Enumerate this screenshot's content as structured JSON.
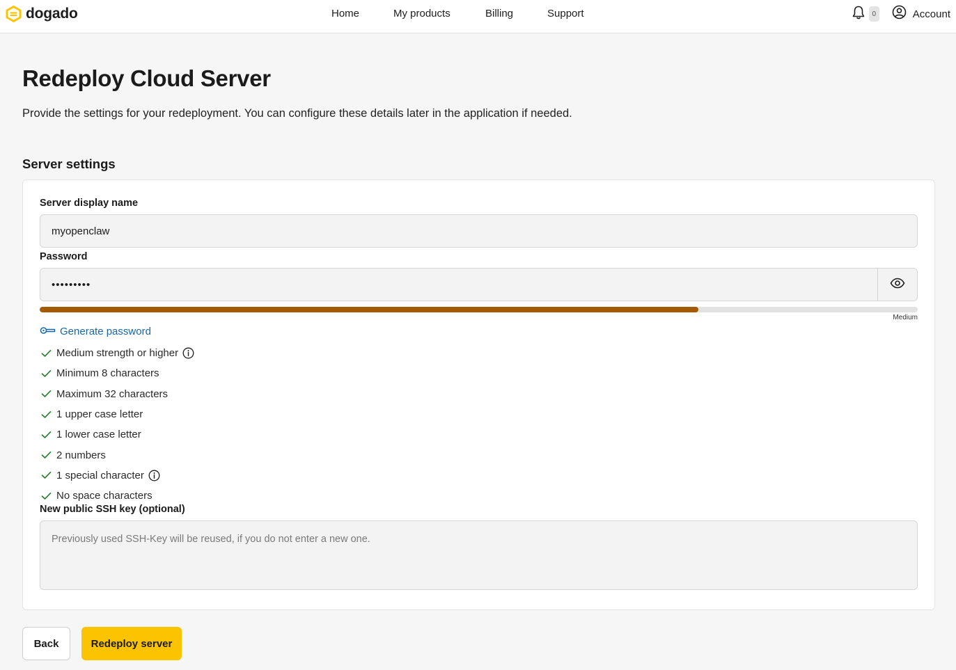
{
  "header": {
    "brand": "dogado",
    "brand_color": "#fcc400",
    "nav": [
      {
        "label": "Home"
      },
      {
        "label": "My products"
      },
      {
        "label": "Billing"
      },
      {
        "label": "Support"
      }
    ],
    "notifications_count": "0",
    "account_label": "Account"
  },
  "page": {
    "title": "Redeploy Cloud Server",
    "subtitle": "Provide the settings for your redeployment. You can configure these details later in the application if needed.",
    "section_title": "Server settings"
  },
  "form": {
    "server_name": {
      "label": "Server display name",
      "value": "myopenclaw"
    },
    "password": {
      "label": "Password",
      "value": "•••••••••",
      "strength_label": "Medium",
      "strength_fraction": 0.75,
      "strength_color": "#a35a00",
      "generate_label": "Generate password",
      "requirements": [
        {
          "text": "Medium strength or higher",
          "info": true
        },
        {
          "text": "Minimum 8 characters",
          "info": false
        },
        {
          "text": "Maximum 32 characters",
          "info": false
        },
        {
          "text": "1 upper case letter",
          "info": false
        },
        {
          "text": "1 lower case letter",
          "info": false
        },
        {
          "text": "2 numbers",
          "info": false
        },
        {
          "text": "1 special character",
          "info": true
        },
        {
          "text": "No space characters",
          "info": false
        }
      ]
    },
    "ssh_key": {
      "label": "New public SSH key (optional)",
      "placeholder": "Previously used SSH-Key will be reused, if you do not enter a new one."
    }
  },
  "actions": {
    "back_label": "Back",
    "submit_label": "Redeploy server"
  },
  "icons": {
    "logo": "dogado-logo-icon",
    "bell": "bell-icon",
    "account": "user-circle-icon",
    "eye": "eye-icon",
    "key": "key-icon",
    "check": "check-icon",
    "info": "info-icon"
  }
}
